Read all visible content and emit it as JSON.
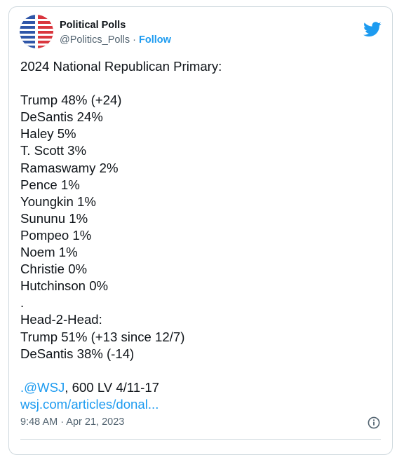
{
  "author": {
    "display_name": "Political Polls",
    "handle": "@Politics_Polls",
    "separator": " · ",
    "follow_label": "Follow"
  },
  "tweet": {
    "lines": [
      "2024 National Republican Primary:",
      "",
      "Trump 48% (+24)",
      "DeSantis 24%",
      "Haley 5%",
      "T. Scott 3%",
      "Ramaswamy 2%",
      "Pence 1%",
      "Youngkin 1%",
      "Sununu 1%",
      "Pompeo 1%",
      "Noem 1%",
      "Christie 0%",
      "Hutchinson 0%",
      ".",
      "Head-2-Head:",
      "Trump 51% (+13 since 12/7)",
      "DeSantis 38% (-14)",
      ""
    ],
    "mention_prefix": ".",
    "mention": "@WSJ",
    "mention_suffix": ", 600 LV 4/11-17",
    "link": "wsj.com/articles/donal..."
  },
  "meta": {
    "timestamp": "9:48 AM · Apr 21, 2023"
  },
  "colors": {
    "accent": "#1d9bf0",
    "text": "#0f1419",
    "muted": "#536471",
    "avatar_red": "#d9363e",
    "avatar_blue": "#2f56a8"
  },
  "icons": {
    "brand": "twitter-bird-icon",
    "info": "info-circle-icon"
  }
}
